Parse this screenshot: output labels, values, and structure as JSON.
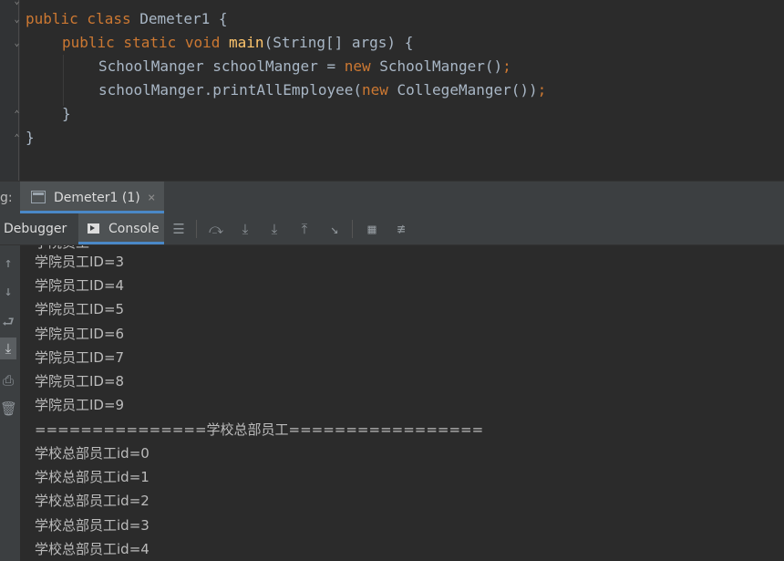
{
  "editor": {
    "lines": [
      {
        "kw1": "public class ",
        "name": "Demeter1 {"
      },
      {
        "kw1": "public static void ",
        "fn": "main",
        "rest": "(String[] args) {"
      },
      {
        "a": "SchoolManger schoolManger = ",
        "kw": "new ",
        "b": "SchoolManger()",
        "semi": ";"
      },
      {
        "a": "schoolManger.printAllEmployee(",
        "kw": "new ",
        "b": "CollegeManger())",
        "semi": ";"
      },
      {
        "text": "}"
      },
      {
        "text": "}"
      }
    ]
  },
  "tool_window": {
    "label": "g:",
    "run_tab_title": "Demeter1 (1)",
    "close_glyph": "×"
  },
  "toolbar": {
    "debugger_label": "Debugger",
    "console_label": "Console"
  },
  "console": {
    "partial_top": "学院员工",
    "lines": [
      "学院员工ID=3",
      "学院员工ID=4",
      "学院员工ID=5",
      "学院员工ID=6",
      "学院员工ID=7",
      "学院员工ID=8",
      "学院员工ID=9",
      "===============学校总部员工=================",
      "学校总部员工id=0",
      "学校总部员工id=1",
      "学校总部员工id=2",
      "学校总部员工id=3",
      "学校总部员工id=4"
    ]
  },
  "icons": {
    "toolbar": [
      "menu-icon",
      "show-execution-point-icon",
      "step-over-icon",
      "step-into-icon",
      "step-out-icon",
      "run-to-cursor-icon",
      "evaluate-expression-icon",
      "trace-icon"
    ],
    "side": [
      "up-arrow-icon",
      "down-arrow-icon",
      "soft-wrap-icon",
      "scroll-to-end-icon",
      "print-icon",
      "trash-icon"
    ]
  },
  "colors": {
    "keyword": "#cc7832",
    "function": "#ffc66d",
    "text": "#a9b7c6",
    "accent": "#4a88c7"
  }
}
